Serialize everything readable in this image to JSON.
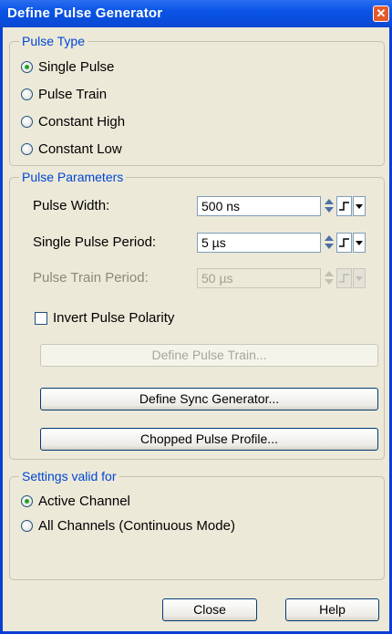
{
  "window": {
    "title": "Define Pulse Generator"
  },
  "pulse_type": {
    "legend": "Pulse Type",
    "options": [
      "Single Pulse",
      "Pulse Train",
      "Constant High",
      "Constant Low"
    ],
    "selected": "Single Pulse"
  },
  "pulse_parameters": {
    "legend": "Pulse Parameters",
    "pulse_width": {
      "label": "Pulse Width:",
      "value": "500 ns"
    },
    "single_pulse_period": {
      "label": "Single Pulse Period:",
      "value": "5 µs"
    },
    "pulse_train_period": {
      "label": "Pulse Train Period:",
      "value": "50 µs"
    },
    "invert_polarity": {
      "label": "Invert Pulse Polarity",
      "checked": false
    },
    "define_pulse_train_label": "Define Pulse Train...",
    "define_sync_label": "Define Sync Generator...",
    "chopped_profile_label": "Chopped Pulse Profile..."
  },
  "settings_valid_for": {
    "legend": "Settings valid for",
    "options": [
      "Active Channel",
      "All Channels (Continuous Mode)"
    ],
    "selected": "Active Channel"
  },
  "footer": {
    "close_label": "Close",
    "help_label": "Help"
  },
  "colors": {
    "titlebar": "#0a54e6",
    "dialog_bg": "#ece9d8",
    "legend_text": "#0046d5",
    "radio_dot": "#21a121"
  }
}
